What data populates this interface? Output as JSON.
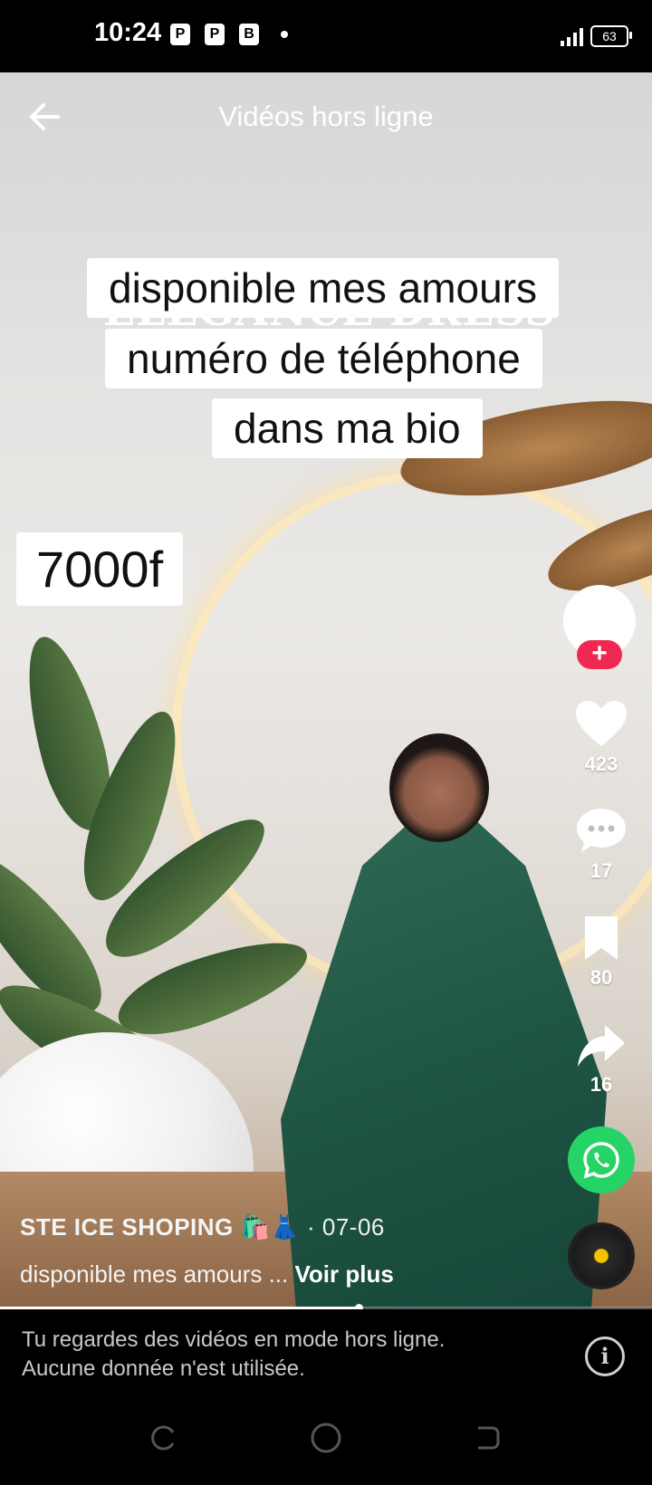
{
  "status_bar": {
    "time": "10:24",
    "app_icons": [
      "P",
      "P",
      "B"
    ],
    "battery": "63"
  },
  "header": {
    "title": "Vidéos hors ligne"
  },
  "video": {
    "brand_text": "ÉLÉGANCE DRESS",
    "caption_lines": [
      "disponible mes amours",
      "numéro de téléphone",
      "dans ma bio"
    ],
    "price": "7000f",
    "progress": 0.55
  },
  "actions": {
    "follow_symbol": "+",
    "likes": "423",
    "comments": "17",
    "saves": "80",
    "shares": "16"
  },
  "post": {
    "author": "STE ICE SHOPING",
    "author_emoji": "🛍️👗",
    "date": "· 07-06",
    "description": "disponible mes amours ...",
    "see_more": "Voir plus"
  },
  "offline_banner": {
    "line1": "Tu regardes des vidéos en mode hors ligne.",
    "line2": "Aucune donnée n'est utilisée.",
    "info_symbol": "i"
  },
  "colors": {
    "follow_red": "#ef2950",
    "whatsapp_green": "#25d366",
    "disc_yellow": "#f2c400"
  }
}
